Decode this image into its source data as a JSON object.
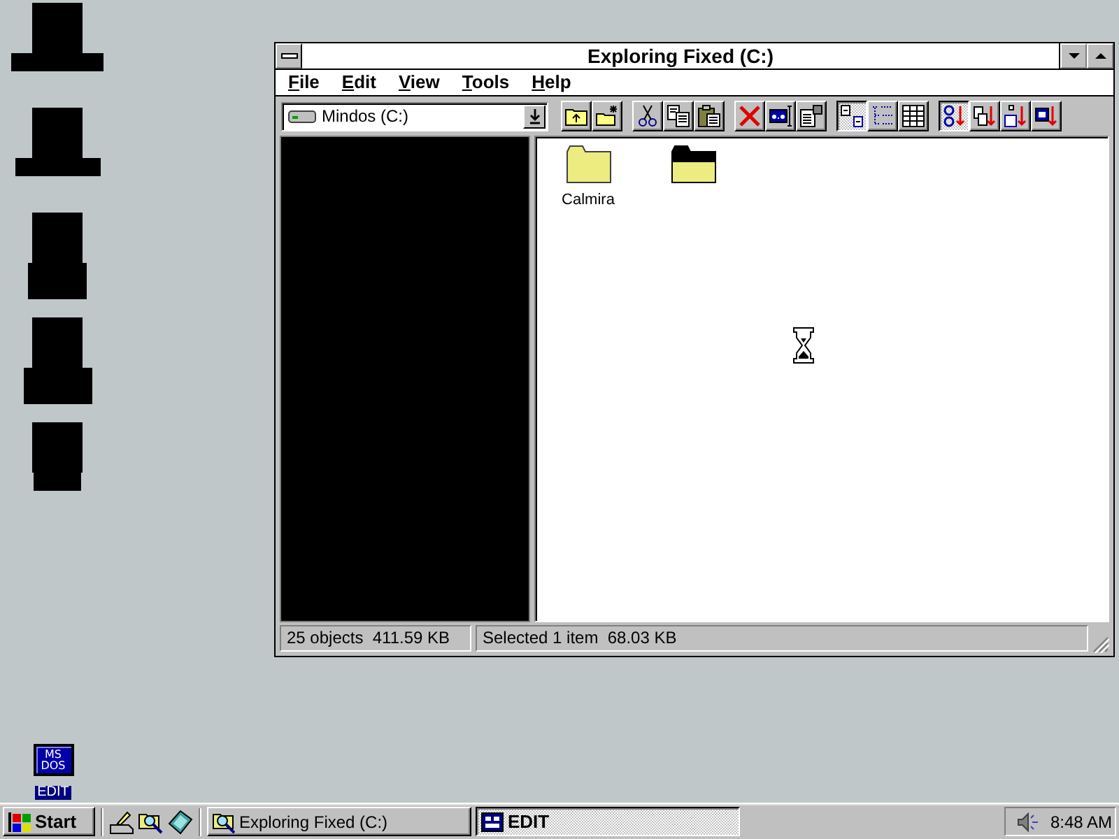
{
  "desktop": {
    "shortcuts": [
      {
        "tile_text": [
          "MS",
          "DOS"
        ],
        "label": "EDIT",
        "selected": true
      }
    ]
  },
  "window": {
    "title": "Exploring Fixed (C:)",
    "menu": [
      "File",
      "Edit",
      "View",
      "Tools",
      "Help"
    ],
    "toolbar": {
      "drive": "Mindos (C:)",
      "groups": [
        {
          "buttons": [
            {
              "kind": "up-one-level"
            },
            {
              "kind": "new-folder"
            }
          ]
        },
        {
          "buttons": [
            {
              "kind": "cut"
            },
            {
              "kind": "copy"
            },
            {
              "kind": "paste"
            }
          ]
        },
        {
          "buttons": [
            {
              "kind": "delete"
            },
            {
              "kind": "rename"
            },
            {
              "kind": "properties"
            }
          ]
        },
        {
          "buttons": [
            {
              "kind": "large-icons",
              "selected": true
            },
            {
              "kind": "list",
              "selected": false
            },
            {
              "kind": "details",
              "selected": false
            }
          ]
        },
        {
          "buttons": [
            {
              "kind": "sort-name",
              "selected": true
            },
            {
              "kind": "sort-type",
              "selected": false
            },
            {
              "kind": "sort-size",
              "selected": false
            },
            {
              "kind": "sort-date",
              "selected": false
            }
          ]
        }
      ]
    },
    "files": [
      {
        "kind": "folder",
        "name": "Calmira"
      },
      {
        "kind": "dark-folder"
      }
    ],
    "status_bar": [
      "25 objects  411.59 KB",
      "Selected 1 item  68.03 KB"
    ]
  },
  "taskbar": {
    "start": "Start",
    "tasks": [
      {
        "kind": "explorer",
        "label": "Exploring Fixed (C:)",
        "selected": false
      },
      {
        "kind": "dos",
        "label": "EDIT",
        "selected": true
      }
    ],
    "clock": "8:48 AM"
  }
}
